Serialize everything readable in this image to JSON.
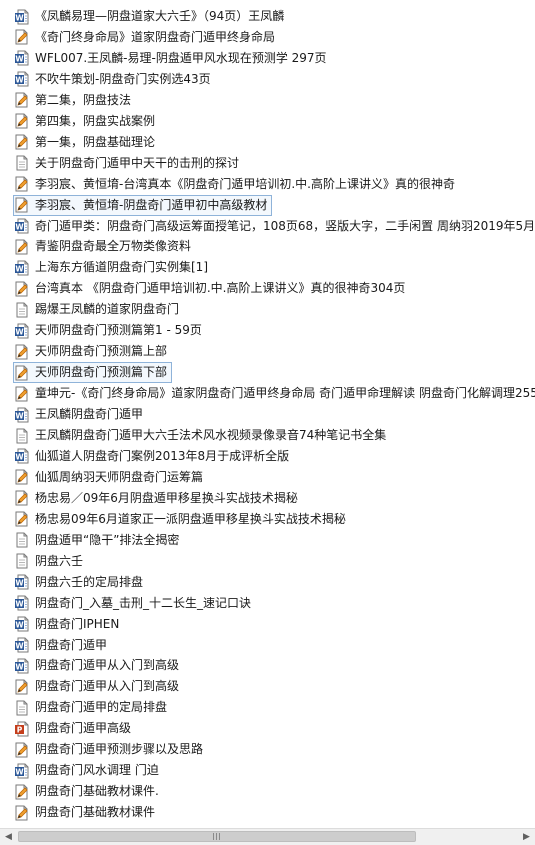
{
  "files": [
    {
      "name": "《凤麟易理—阴盘道家大六壬》（94页）王凤麟",
      "icon": "word-doc-icon"
    },
    {
      "name": "《奇门终身命局》道家阴盘奇门遁甲终身命局",
      "icon": "pencil-doc-icon"
    },
    {
      "name": "WFL007.王凤麟-易理-阴盘遁甲风水现在预测学 297页",
      "icon": "word-doc-icon"
    },
    {
      "name": "不吹牛策划-阴盘奇门实例选43页",
      "icon": "word-doc-icon"
    },
    {
      "name": "第二集，阴盘技法",
      "icon": "pencil-doc-icon"
    },
    {
      "name": "第四集，阴盘实战案例",
      "icon": "pencil-doc-icon"
    },
    {
      "name": "第一集，阴盘基础理论",
      "icon": "pencil-doc-icon"
    },
    {
      "name": "关于阴盘奇门遁甲中天干的击刑的探讨",
      "icon": "text-doc-icon"
    },
    {
      "name": "李羽宸、黄恒堉-台湾真本《阴盘奇门遁甲培训初.中.高阶上课讲义》真的很神奇",
      "icon": "pencil-doc-icon"
    },
    {
      "name": "李羽宸、黄恒堉-阴盘奇门遁甲初中高级教材",
      "icon": "pencil-doc-icon",
      "selected": true
    },
    {
      "name": "奇门遁甲类：阴盘奇门高级运筹面授笔记，108页68，竖版大字，二手闲置 周纳羽2019年5月",
      "icon": "word-doc-icon"
    },
    {
      "name": "青鉴阴盘奇最全万物类像资料",
      "icon": "pencil-doc-icon"
    },
    {
      "name": "上海东方循道阴盘奇门实例集[1]",
      "icon": "word-doc-icon"
    },
    {
      "name": "台湾真本 《阴盘奇门遁甲培训初.中.高阶上课讲义》真的很神奇304页",
      "icon": "pencil-doc-icon"
    },
    {
      "name": "踢爆王凤麟的道家阴盘奇门",
      "icon": "text-doc-icon"
    },
    {
      "name": "天师阴盘奇门预测篇第1 - 59页",
      "icon": "word-doc-icon"
    },
    {
      "name": "天师阴盘奇门预测篇上部",
      "icon": "pencil-doc-icon"
    },
    {
      "name": "天师阴盘奇门预测篇下部",
      "icon": "pencil-doc-icon",
      "selected": true
    },
    {
      "name": "童坤元-《奇门终身命局》道家阴盘奇门遁甲终身命局 奇门遁甲命理解读 阴盘奇门化解调理255",
      "icon": "pencil-doc-icon"
    },
    {
      "name": "王凤麟阴盘奇门遁甲",
      "icon": "word-doc-icon"
    },
    {
      "name": "王凤麟阴盘奇门遁甲大六壬法术风水视频录像录音74种笔记书全集",
      "icon": "text-doc-icon"
    },
    {
      "name": "仙狐道人阴盘奇门案例2013年8月于成评析全版",
      "icon": "word-doc-icon"
    },
    {
      "name": "仙狐周纳羽天师阴盘奇门运筹篇",
      "icon": "pencil-doc-icon"
    },
    {
      "name": "杨忠易／09年6月阴盘遁甲移星换斗实战技术揭秘",
      "icon": "pencil-doc-icon"
    },
    {
      "name": "杨忠易09年6月道家正一派阴盘遁甲移星换斗实战技术揭秘",
      "icon": "pencil-doc-icon"
    },
    {
      "name": "阴盘遁甲“隐干”排法全揭密",
      "icon": "text-doc-icon"
    },
    {
      "name": "阴盘六壬",
      "icon": "text-doc-icon"
    },
    {
      "name": "阴盘六壬的定局排盘",
      "icon": "word-doc-icon"
    },
    {
      "name": "阴盘奇门_入墓_击刑_十二长生_速记口诀",
      "icon": "word-doc-icon"
    },
    {
      "name": "阴盘奇门IPHEN",
      "icon": "word-doc-icon"
    },
    {
      "name": "阴盘奇门遁甲",
      "icon": "word-doc-icon"
    },
    {
      "name": "阴盘奇门遁甲从入门到高级",
      "icon": "word-doc-icon"
    },
    {
      "name": "阴盘奇门遁甲从入门到高级",
      "icon": "pencil-doc-icon"
    },
    {
      "name": "阴盘奇门遁甲的定局排盘",
      "icon": "text-doc-icon"
    },
    {
      "name": "阴盘奇门遁甲高级",
      "icon": "ppt-doc-icon"
    },
    {
      "name": "阴盘奇门遁甲预测步骤以及思路",
      "icon": "pencil-doc-icon"
    },
    {
      "name": "阴盘奇门风水调理 门迫",
      "icon": "word-doc-icon"
    },
    {
      "name": "阴盘奇门基础教材课件.",
      "icon": "pencil-doc-icon"
    },
    {
      "name": "阴盘奇门基础教材课件",
      "icon": "pencil-doc-icon"
    }
  ],
  "scrollbar": {
    "left_arrow": "◀",
    "right_arrow": "▶",
    "position": 0.0
  },
  "colors": {
    "selection_border": "#8fb3d9",
    "word_blue": "#2b5797",
    "pencil_orange": "#e07a10",
    "ppt_red": "#c43e1c"
  }
}
